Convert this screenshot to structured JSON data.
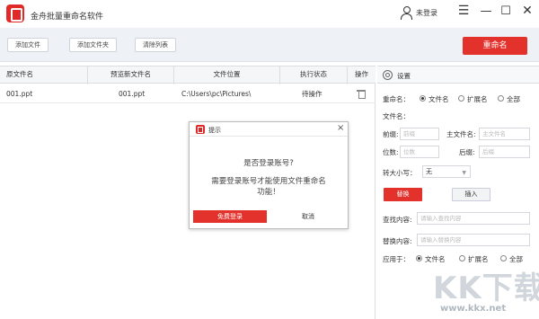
{
  "app": {
    "title": "金舟批量重命名软件",
    "login_label": "未登录"
  },
  "toolbar": {
    "add_file": "添加文件",
    "add_folder": "添加文件夹",
    "clear_list": "清除列表",
    "rename": "重命名"
  },
  "table": {
    "columns": [
      "原文件名",
      "预览新文件名",
      "文件位置",
      "执行状态",
      "操作"
    ],
    "rows": [
      {
        "original": "001.ppt",
        "preview": "001.ppt",
        "location": "C:\\Users\\pc\\Pictures\\",
        "status": "待操作"
      }
    ]
  },
  "panel": {
    "title": "设置",
    "rename_label": "重命名：",
    "rename_options": [
      "文件名",
      "扩展名",
      "全部"
    ],
    "filename_label": "文件名：",
    "prefix_label": "前缀:",
    "prefix_placeholder": "前缀",
    "main_label": "主文件名:",
    "main_placeholder": "主文件名",
    "digits_label": "位数:",
    "digits_placeholder": "位数",
    "suffix_label": "后缀:",
    "suffix_placeholder": "后缀",
    "case_label": "转大小写：",
    "case_value": "无",
    "replace_button": "替换",
    "insert_button": "插入",
    "find_label": "查找内容:",
    "find_placeholder": "请输入查找内容",
    "replace_label": "替换内容:",
    "replace_placeholder": "请输入替换内容",
    "apply_label": "应用于：",
    "apply_options": [
      "文件名",
      "扩展名",
      "全部"
    ]
  },
  "dialog": {
    "title": "提示",
    "line1": "是否登录账号?",
    "line2": "需要登录账号才能使用文件重命名",
    "line3": "功能！",
    "login": "免费登录",
    "cancel": "取消"
  },
  "watermark": {
    "logo": "KK下载",
    "url": "www.kkx.net"
  },
  "colors": {
    "accent": "#e3322c"
  }
}
